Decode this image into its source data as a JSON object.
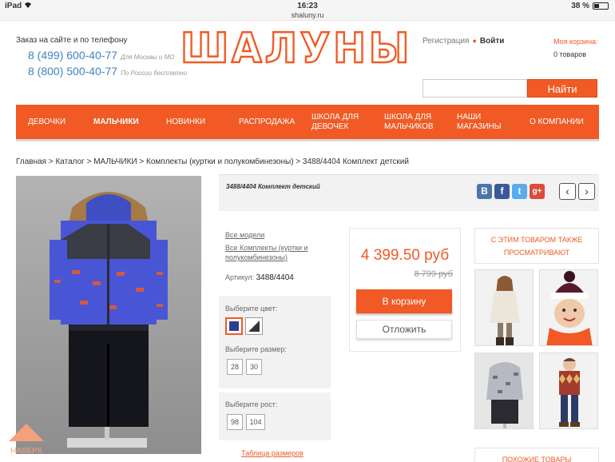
{
  "status_bar": {
    "device": "iPad",
    "wifi_icon": "wifi-icon",
    "time": "16:23",
    "url": "shaluny.ru",
    "battery": "38 %",
    "battery_level": 0.38
  },
  "header": {
    "order_label": "Заказ на сайте и по телефону",
    "phones": [
      {
        "number": "8 (499) 600-40-77",
        "note": "Для Москвы и МО"
      },
      {
        "number": "8 (800) 500-40-77",
        "note": "По России бесплатно"
      }
    ],
    "logo_text": "ШАЛУНЫ",
    "register_label": "Регистрация",
    "login_label": "Войти",
    "cart_title": "Моя корзина:",
    "cart_count": "0 товаров",
    "search_placeholder": "",
    "search_button": "Найти"
  },
  "nav": [
    {
      "label": "ДЕВОЧКИ",
      "bold": false
    },
    {
      "label": "МАЛЬЧИКИ",
      "bold": true
    },
    {
      "label": "НОВИНКИ",
      "bold": false
    },
    {
      "label": "РАСПРОДАЖА",
      "bold": false
    },
    {
      "label": "ШКОЛА ДЛЯ ДЕВОЧЕК",
      "bold": false
    },
    {
      "label": "ШКОЛА ДЛЯ МАЛЬЧИКОВ",
      "bold": false
    },
    {
      "label": "НАШИ МАГАЗИНЫ",
      "bold": false
    },
    {
      "label": "О КОМПАНИИ",
      "bold": false
    }
  ],
  "breadcrumb": "Главная > Каталог > МАЛЬЧИКИ > Комплекты (куртки и полукомбинезоны) > 3488/4404 Комплект детский",
  "product": {
    "title": "3488/4404 Комплект детский",
    "all_models_link": "Все модели",
    "category_link": "Все Комплекты (куртки и полукомбинезоны)",
    "article_label": "Артикул:",
    "article_value": "3488/4404",
    "color_label": "Выберите цвет:",
    "colors": [
      "#2c3f8f",
      "#333333"
    ],
    "size_label": "Выберите размер:",
    "sizes": [
      "28",
      "30"
    ],
    "height_label": "Выберите рост:",
    "heights": [
      "98",
      "104"
    ],
    "size_table_link": "Таблица размеров",
    "price": "4 399.50 руб",
    "old_price": "8 799 руб",
    "cart_button": "В корзину",
    "defer_button": "Отложить"
  },
  "social": [
    {
      "icon": "vk-icon",
      "glyph": "В",
      "color": "#4a76a8"
    },
    {
      "icon": "facebook-icon",
      "glyph": "f",
      "color": "#3b5998"
    },
    {
      "icon": "twitter-icon",
      "glyph": "t",
      "color": "#55acee"
    },
    {
      "icon": "google-plus-icon",
      "glyph": "g+",
      "color": "#dd4b39"
    }
  ],
  "side": {
    "also_viewed": "С ЭТИМ ТОВАРОМ ТАКЖЕ ПРОСМАТРИВАЮТ",
    "similar": "ПОХОЖИЕ ТОВАРЫ"
  },
  "to_top": "НАВЕРХ",
  "colors": {
    "accent": "#f15a24",
    "link_blue": "#3e84c4"
  }
}
